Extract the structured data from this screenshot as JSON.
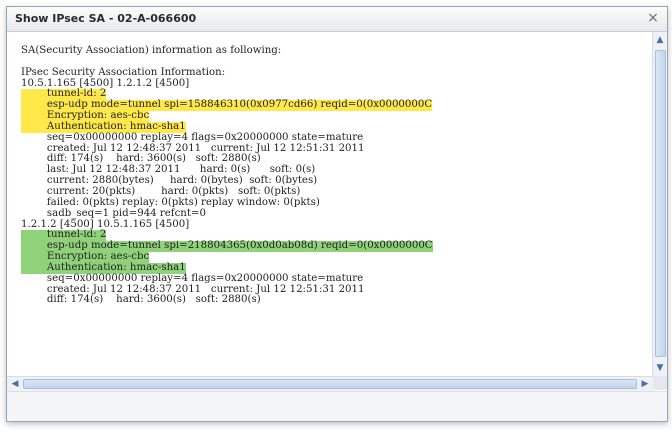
{
  "window": {
    "title": "Show IPsec SA - 02-A-066600",
    "close_glyph": "×"
  },
  "content": {
    "intro": "SA(Security Association) information as following:",
    "header_lines": [
      "IPsec Security Association Information:",
      "10.5.1.165 [4500] 1.2.1.2 [4500]"
    ],
    "sa1_highlight": [
      "        tunnel-id: 2",
      "        esp-udp mode=tunnel spi=158846310(0x0977cd66) reqid=0(0x0000000C",
      "        Encryption: aes-cbc",
      "        Authentication: hmac-sha1"
    ],
    "sa1_details": [
      "        seq=0x00000000 replay=4 flags=0x20000000 state=mature",
      "        created: Jul 12 12:48:37 2011   current: Jul 12 12:51:31 2011",
      "        diff: 174(s)    hard: 3600(s)   soft: 2880(s)",
      "        last: Jul 12 12:48:37 2011      hard: 0(s)      soft: 0(s)",
      "        current: 2880(bytes)     hard: 0(bytes)  soft: 0(bytes)",
      "        current: 20(pkts)        hard: 0(pkts)   soft: 0(pkts)",
      "        failed: 0(pkts) replay: 0(pkts) replay window: 0(pkts)",
      "        sadb_seq=1 pid=944 refcnt=0"
    ],
    "sa2_header": "1.2.1.2 [4500] 10.5.1.165 [4500]",
    "sa2_highlight": [
      "        tunnel-id: 2",
      "        esp-udp mode=tunnel spi=218804365(0x0d0ab08d) reqid=0(0x0000000C",
      "        Encryption: aes-cbc",
      "        Authentication: hmac-sha1"
    ],
    "sa2_details": [
      "        seq=0x00000000 replay=4 flags=0x20000000 state=mature",
      "        created: Jul 12 12:48:37 2011   current: Jul 12 12:51:31 2011",
      "        diff: 174(s)    hard: 3600(s)   soft: 2880(s)"
    ]
  },
  "colors": {
    "highlight_yellow": "#ffe94a",
    "highlight_green": "#8fd27a"
  },
  "scrollbars": {
    "up_arrow": "▲",
    "down_arrow": "▼",
    "left_arrow": "◀",
    "right_arrow": "▶"
  }
}
